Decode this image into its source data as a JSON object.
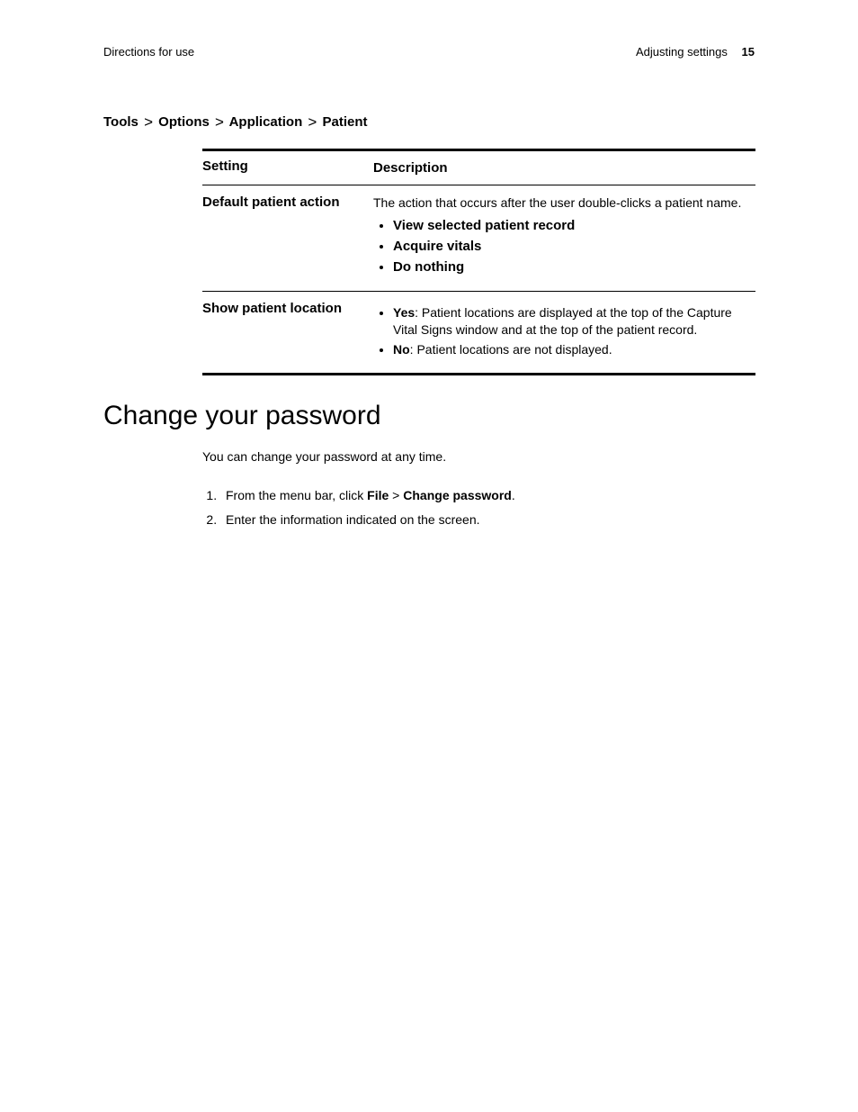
{
  "header": {
    "left": "Directions for use",
    "right_text": "Adjusting settings",
    "page_number": "15"
  },
  "breadcrumb": [
    "Tools",
    "Options",
    "Application",
    "Patient"
  ],
  "table": {
    "head": {
      "setting": "Setting",
      "description": "Description"
    },
    "rows": [
      {
        "setting": "Default patient action",
        "description_intro": "The action that occurs after the user double-clicks a patient name.",
        "bullets_bold": [
          "View selected patient record",
          "Acquire vitals",
          "Do nothing"
        ]
      },
      {
        "setting": "Show patient location",
        "bullets": [
          {
            "lead": "Yes",
            "text": ": Patient locations are displayed at the top of the Capture Vital Signs window and at the top of the patient record."
          },
          {
            "lead": "No",
            "text": ": Patient locations are not displayed."
          }
        ]
      }
    ]
  },
  "section": {
    "title": "Change your password",
    "intro": "You can change your password at any time.",
    "steps": [
      {
        "prefix": "From the menu bar, click ",
        "b1": "File",
        "sep": " > ",
        "b2": "Change password",
        "suffix": "."
      },
      {
        "text": "Enter the information indicated on the screen."
      }
    ]
  }
}
